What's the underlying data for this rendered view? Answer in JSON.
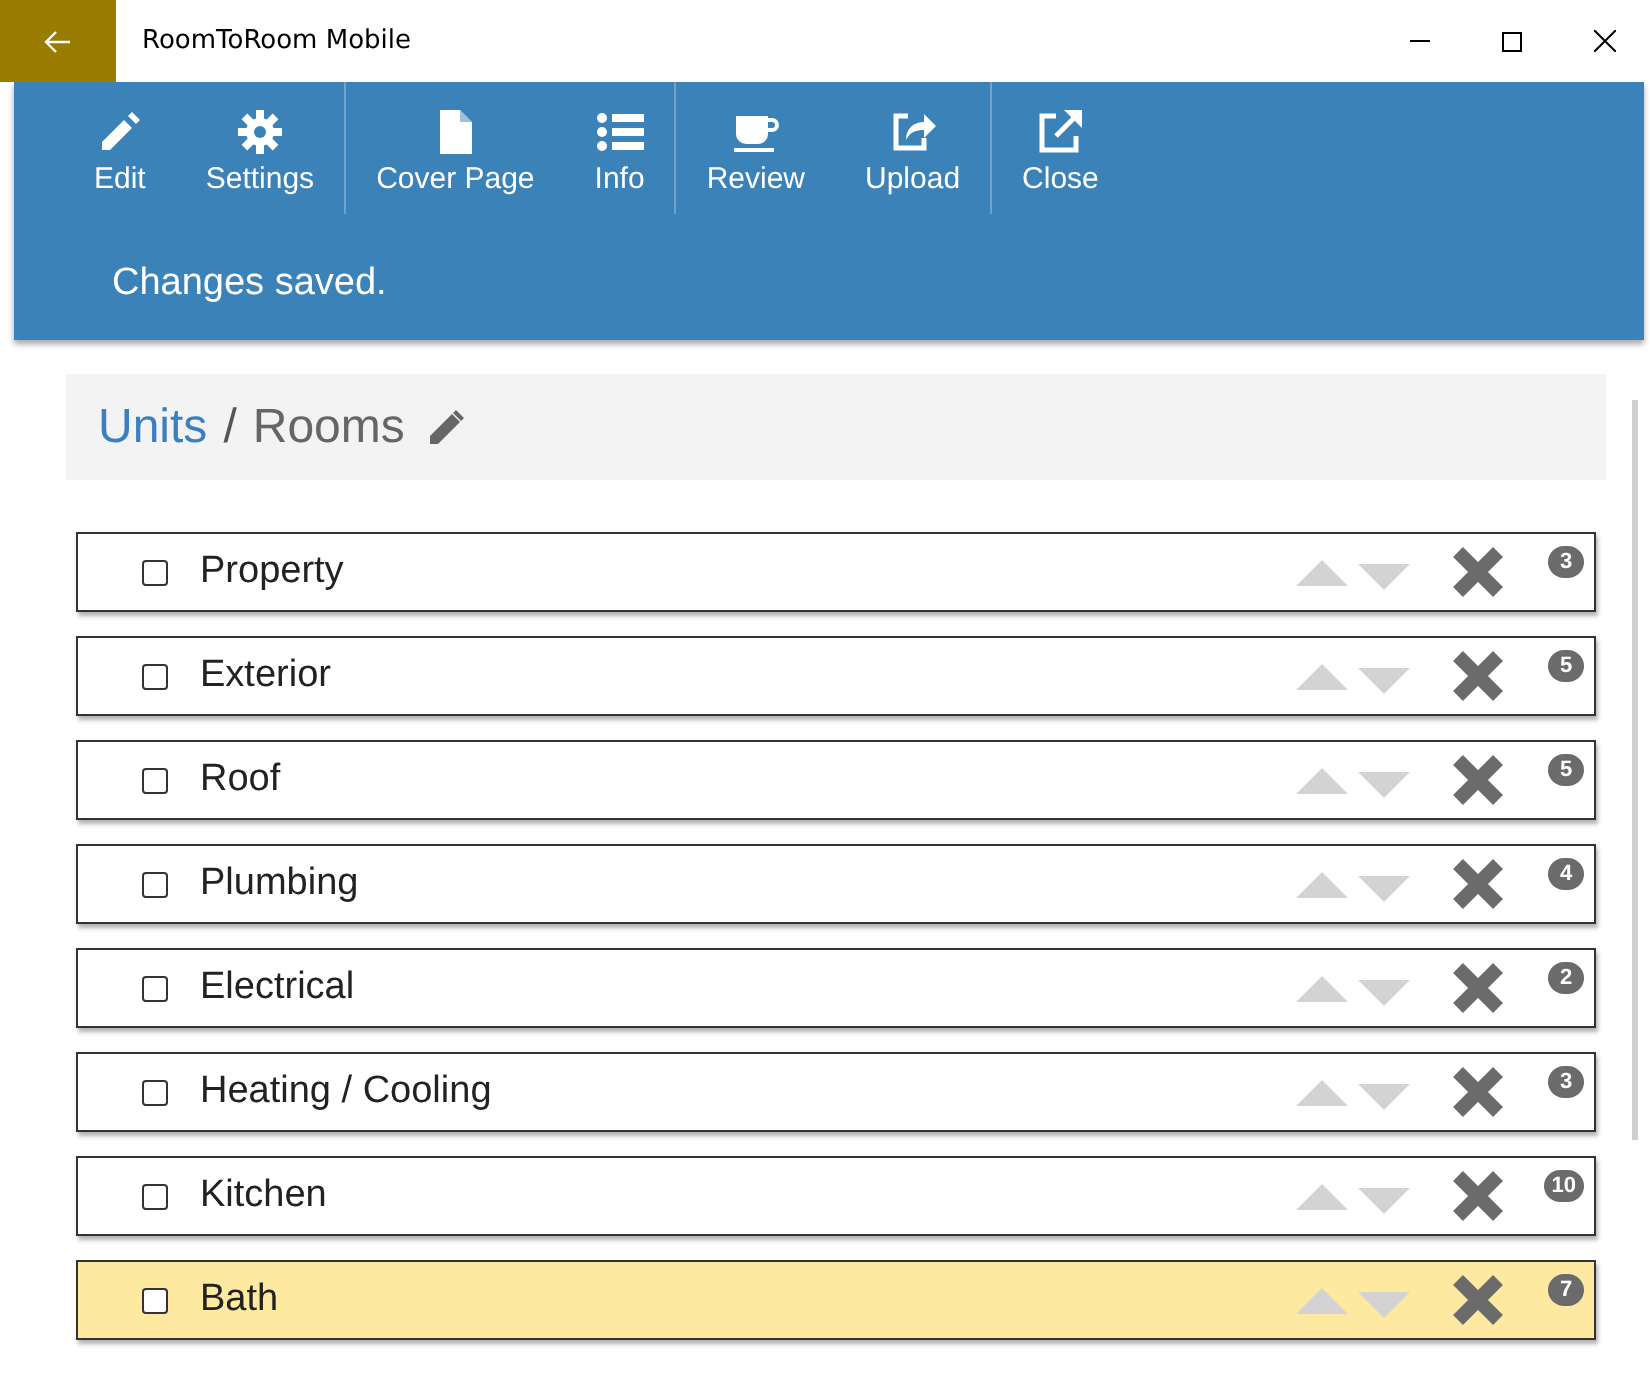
{
  "window": {
    "title": "RoomToRoom Mobile"
  },
  "toolbar": {
    "groups": [
      [
        {
          "label": "Edit"
        },
        {
          "label": "Settings"
        }
      ],
      [
        {
          "label": "Cover Page"
        },
        {
          "label": "Info"
        }
      ],
      [
        {
          "label": "Review"
        },
        {
          "label": "Upload"
        }
      ],
      [
        {
          "label": "Close"
        }
      ]
    ],
    "message": "Changes saved."
  },
  "breadcrumb": {
    "link": "Units",
    "separator": "/",
    "current": "Rooms"
  },
  "rooms": [
    {
      "name": "Property",
      "count": "3",
      "checked": false,
      "selected": false
    },
    {
      "name": "Exterior",
      "count": "5",
      "checked": false,
      "selected": false
    },
    {
      "name": "Roof",
      "count": "5",
      "checked": false,
      "selected": false
    },
    {
      "name": "Plumbing",
      "count": "4",
      "checked": false,
      "selected": false
    },
    {
      "name": "Electrical",
      "count": "2",
      "checked": false,
      "selected": false
    },
    {
      "name": "Heating / Cooling",
      "count": "3",
      "checked": false,
      "selected": false
    },
    {
      "name": "Kitchen",
      "count": "10",
      "checked": false,
      "selected": false
    },
    {
      "name": "Bath",
      "count": "7",
      "checked": false,
      "selected": true
    }
  ]
}
